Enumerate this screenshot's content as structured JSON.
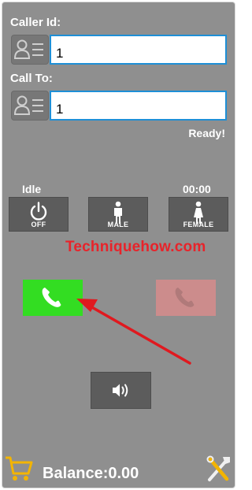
{
  "caller": {
    "label": "Caller Id:",
    "value": "1"
  },
  "callto": {
    "label": "Call To:",
    "value": "1"
  },
  "status": "Ready!",
  "call_state": {
    "state": "Idle",
    "timer": "00:00"
  },
  "controls": {
    "off_label": "OFF",
    "male_label": "MALE",
    "female_label": "FEMALE"
  },
  "watermark": "Techniquehow.com",
  "icons": {
    "contact": "contact-card-icon",
    "power": "power-icon",
    "male": "male-person-icon",
    "female": "female-person-icon",
    "call": "phone-call-icon",
    "hangup": "phone-hangup-icon",
    "speaker": "speaker-icon",
    "cart": "cart-icon",
    "tools": "tools-icon"
  },
  "colors": {
    "call_green": "#33dd22",
    "hangup_red": "#cc8c8c",
    "arrow_red": "#e0191f",
    "cart_yellow": "#f3b400",
    "field_border": "#1e8fd6"
  },
  "balance": "Balance:0.00"
}
